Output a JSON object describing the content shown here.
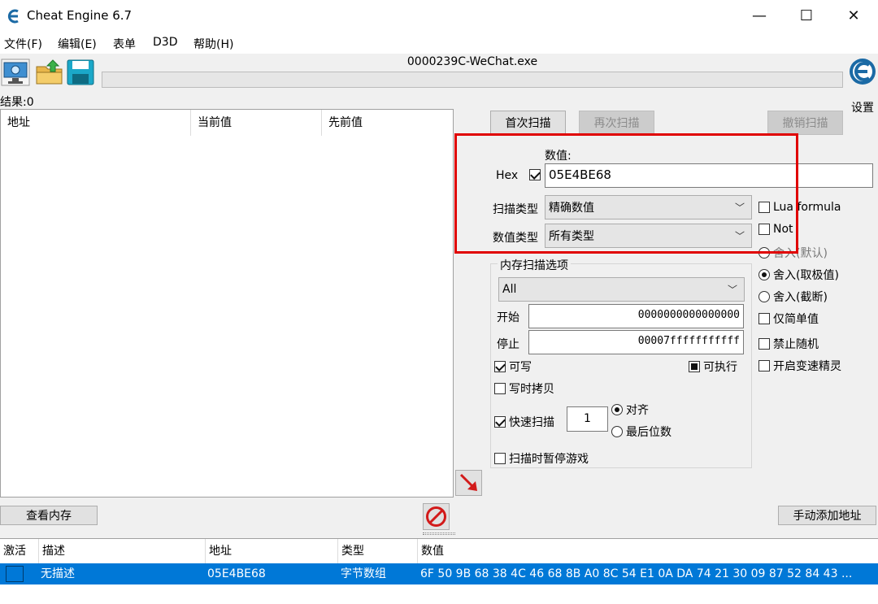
{
  "window": {
    "title": "Cheat Engine 6.7",
    "minimize": "—",
    "maximize": "☐",
    "close": "✕"
  },
  "menu": [
    "文件(F)",
    "编辑(E)",
    "表单",
    "D3D",
    "帮助(H)"
  ],
  "toolbar": {
    "process_title": "0000239C-WeChat.exe",
    "settings_label": "设置"
  },
  "results": {
    "count_label": "结果:0",
    "columns": [
      "地址",
      "当前值",
      "先前值"
    ]
  },
  "scan": {
    "first_scan": "首次扫描",
    "next_scan": "再次扫描",
    "undo_scan": "撤销扫描",
    "value_label": "数值:",
    "hex_label": "Hex",
    "hex_checked": true,
    "value": "05E4BE68",
    "scan_type_label": "扫描类型",
    "scan_type": "精确数值",
    "value_type_label": "数值类型",
    "value_type": "所有类型"
  },
  "options_right": {
    "lua_formula": "Lua formula",
    "not": "Not",
    "round_default": "舍入(默认)",
    "round_extreme": "舍入(取极值)",
    "round_truncate": "舍入(截断)",
    "simple_values_only": "仅简单值",
    "disable_random": "禁止随机",
    "speedhack": "开启变速精灵"
  },
  "memory_options": {
    "group_label": "内存扫描选项",
    "region": "All",
    "start_label": "开始",
    "start_value": "0000000000000000",
    "stop_label": "停止",
    "stop_value": "00007fffffffffff",
    "writable": "可写",
    "executable": "可执行",
    "copy_on_write": "写时拷贝",
    "fast_scan": "快速扫描",
    "fast_scan_value": "1",
    "alignment": "对齐",
    "last_digits": "最后位数",
    "pause_game": "扫描时暂停游戏"
  },
  "buttons": {
    "view_memory": "查看内存",
    "add_address": "手动添加地址"
  },
  "address_table": {
    "columns": [
      "激活",
      "描述",
      "地址",
      "类型",
      "数值"
    ],
    "rows": [
      {
        "active": "",
        "description": "无描述",
        "address": "05E4BE68",
        "type": "字节数组",
        "value": "6F 50 9B 68 38 4C 46 68 8B A0 8C 54 E1 0A DA 74 21 30 09 87 52 84 43 ..."
      }
    ]
  },
  "colors": {
    "selection": "#0078d7",
    "highlight_box": "#e00000",
    "logo_blue": "#1b6aa5"
  }
}
